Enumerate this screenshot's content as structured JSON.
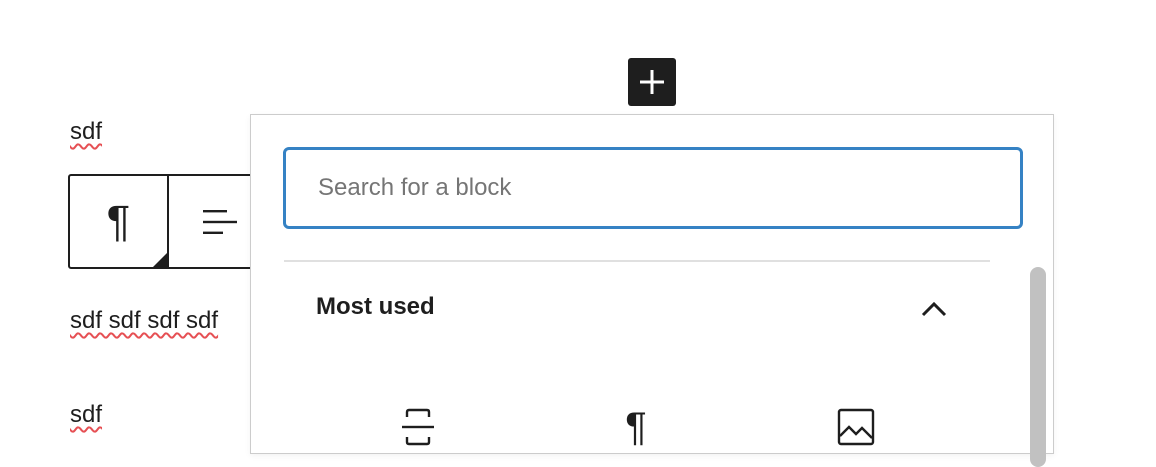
{
  "editor": {
    "paragraphs": [
      {
        "text": "sdf"
      },
      {
        "text": "sdf sdf sdf sdf"
      },
      {
        "text": "sdf"
      }
    ]
  },
  "toolbar": {
    "paragraph_icon_glyph": "¶",
    "buttons": [
      {
        "icon": "paragraph-icon"
      },
      {
        "icon": "align-left-icon"
      }
    ]
  },
  "inserter_toggle": {
    "icon": "plus-icon"
  },
  "inserter": {
    "search": {
      "placeholder": "Search for a block",
      "value": ""
    },
    "panel": {
      "title": "Most used",
      "expanded": true,
      "blocks": [
        {
          "icon": "separator-icon"
        },
        {
          "icon": "paragraph-icon",
          "glyph": "¶"
        },
        {
          "icon": "image-icon"
        }
      ]
    }
  },
  "colors": {
    "focus_border": "#3582c4",
    "text": "#1e1e1e",
    "spell_underline": "#e65054"
  }
}
